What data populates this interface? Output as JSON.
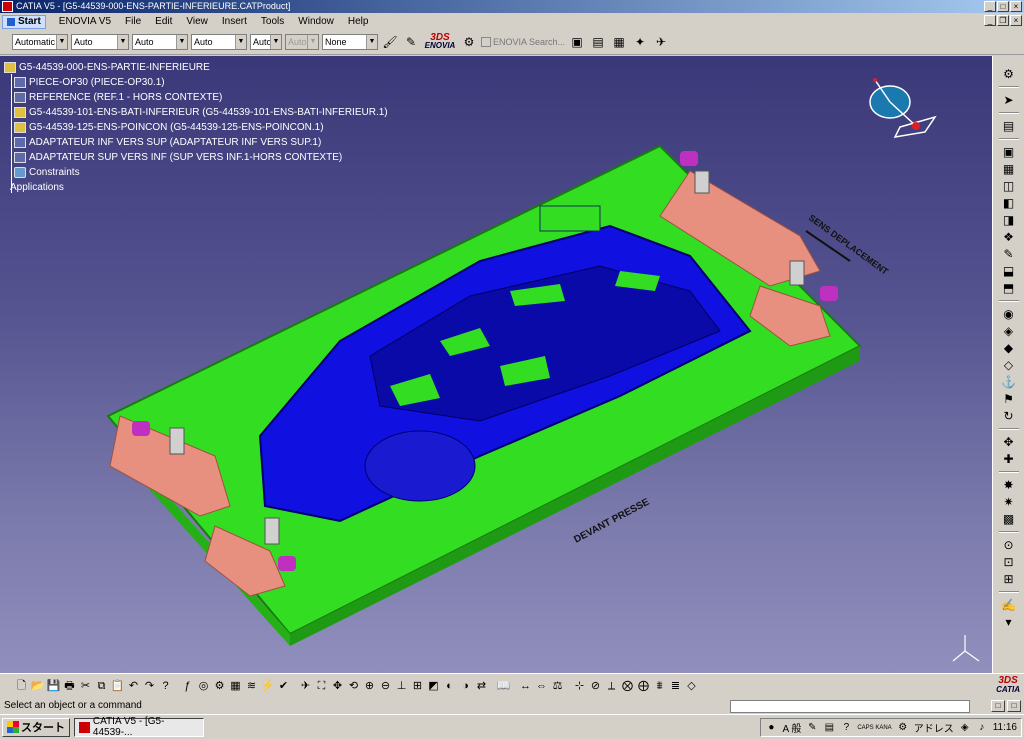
{
  "window": {
    "title": "CATIA V5 - [G5-44539-000-ENS-PARTIE-INFERIEURE.CATProduct]"
  },
  "menu": {
    "start": "Start",
    "items": [
      "ENOVIA V5",
      "File",
      "Edit",
      "View",
      "Insert",
      "Tools",
      "Window",
      "Help"
    ]
  },
  "toolbar": {
    "combos": [
      "Automatic",
      "Auto",
      "Auto",
      "Auto",
      "Auto",
      "Auto",
      "None"
    ],
    "enovia_logo": "ENOVIA",
    "enovia_search": "ENOVIA Search..."
  },
  "tree": {
    "root": "G5-44539-000-ENS-PARTIE-INFERIEURE",
    "children": [
      "PIECE-OP30 (PIECE-OP30.1)",
      "REFERENCE (REF.1 - HORS CONTEXTE)",
      "G5-44539-101-ENS-BATI-INFERIEUR (G5-44539-101-ENS-BATI-INFERIEUR.1)",
      "G5-44539-125-ENS-POINCON (G5-44539-125-ENS-POINCON.1)",
      "ADAPTATEUR INF VERS SUP (ADAPTATEUR INF VERS SUP.1)",
      "ADAPTATEUR SUP VERS INF (SUP VERS INF.1-HORS CONTEXTE)",
      "Constraints"
    ],
    "applications": "Applications"
  },
  "viewport": {
    "label_front": "DEVANT PRESSE",
    "label_side": "SENS DEPLACEMENT"
  },
  "bottom_logo": "CATIA",
  "status": {
    "message": "Select an object or a command"
  },
  "taskbar": {
    "start": "スタート",
    "task": "CATIA V5 - [G5-44539-...",
    "ime": "A 般",
    "caps": "CAPS KANA",
    "address": "アドレス",
    "time": "11:16"
  },
  "colors": {
    "base_plate": "#33dd22",
    "punch": "#1010e0",
    "guide_blocks": "#e89080",
    "viewport_top": "#3a3878",
    "viewport_bottom": "#908fbd"
  }
}
